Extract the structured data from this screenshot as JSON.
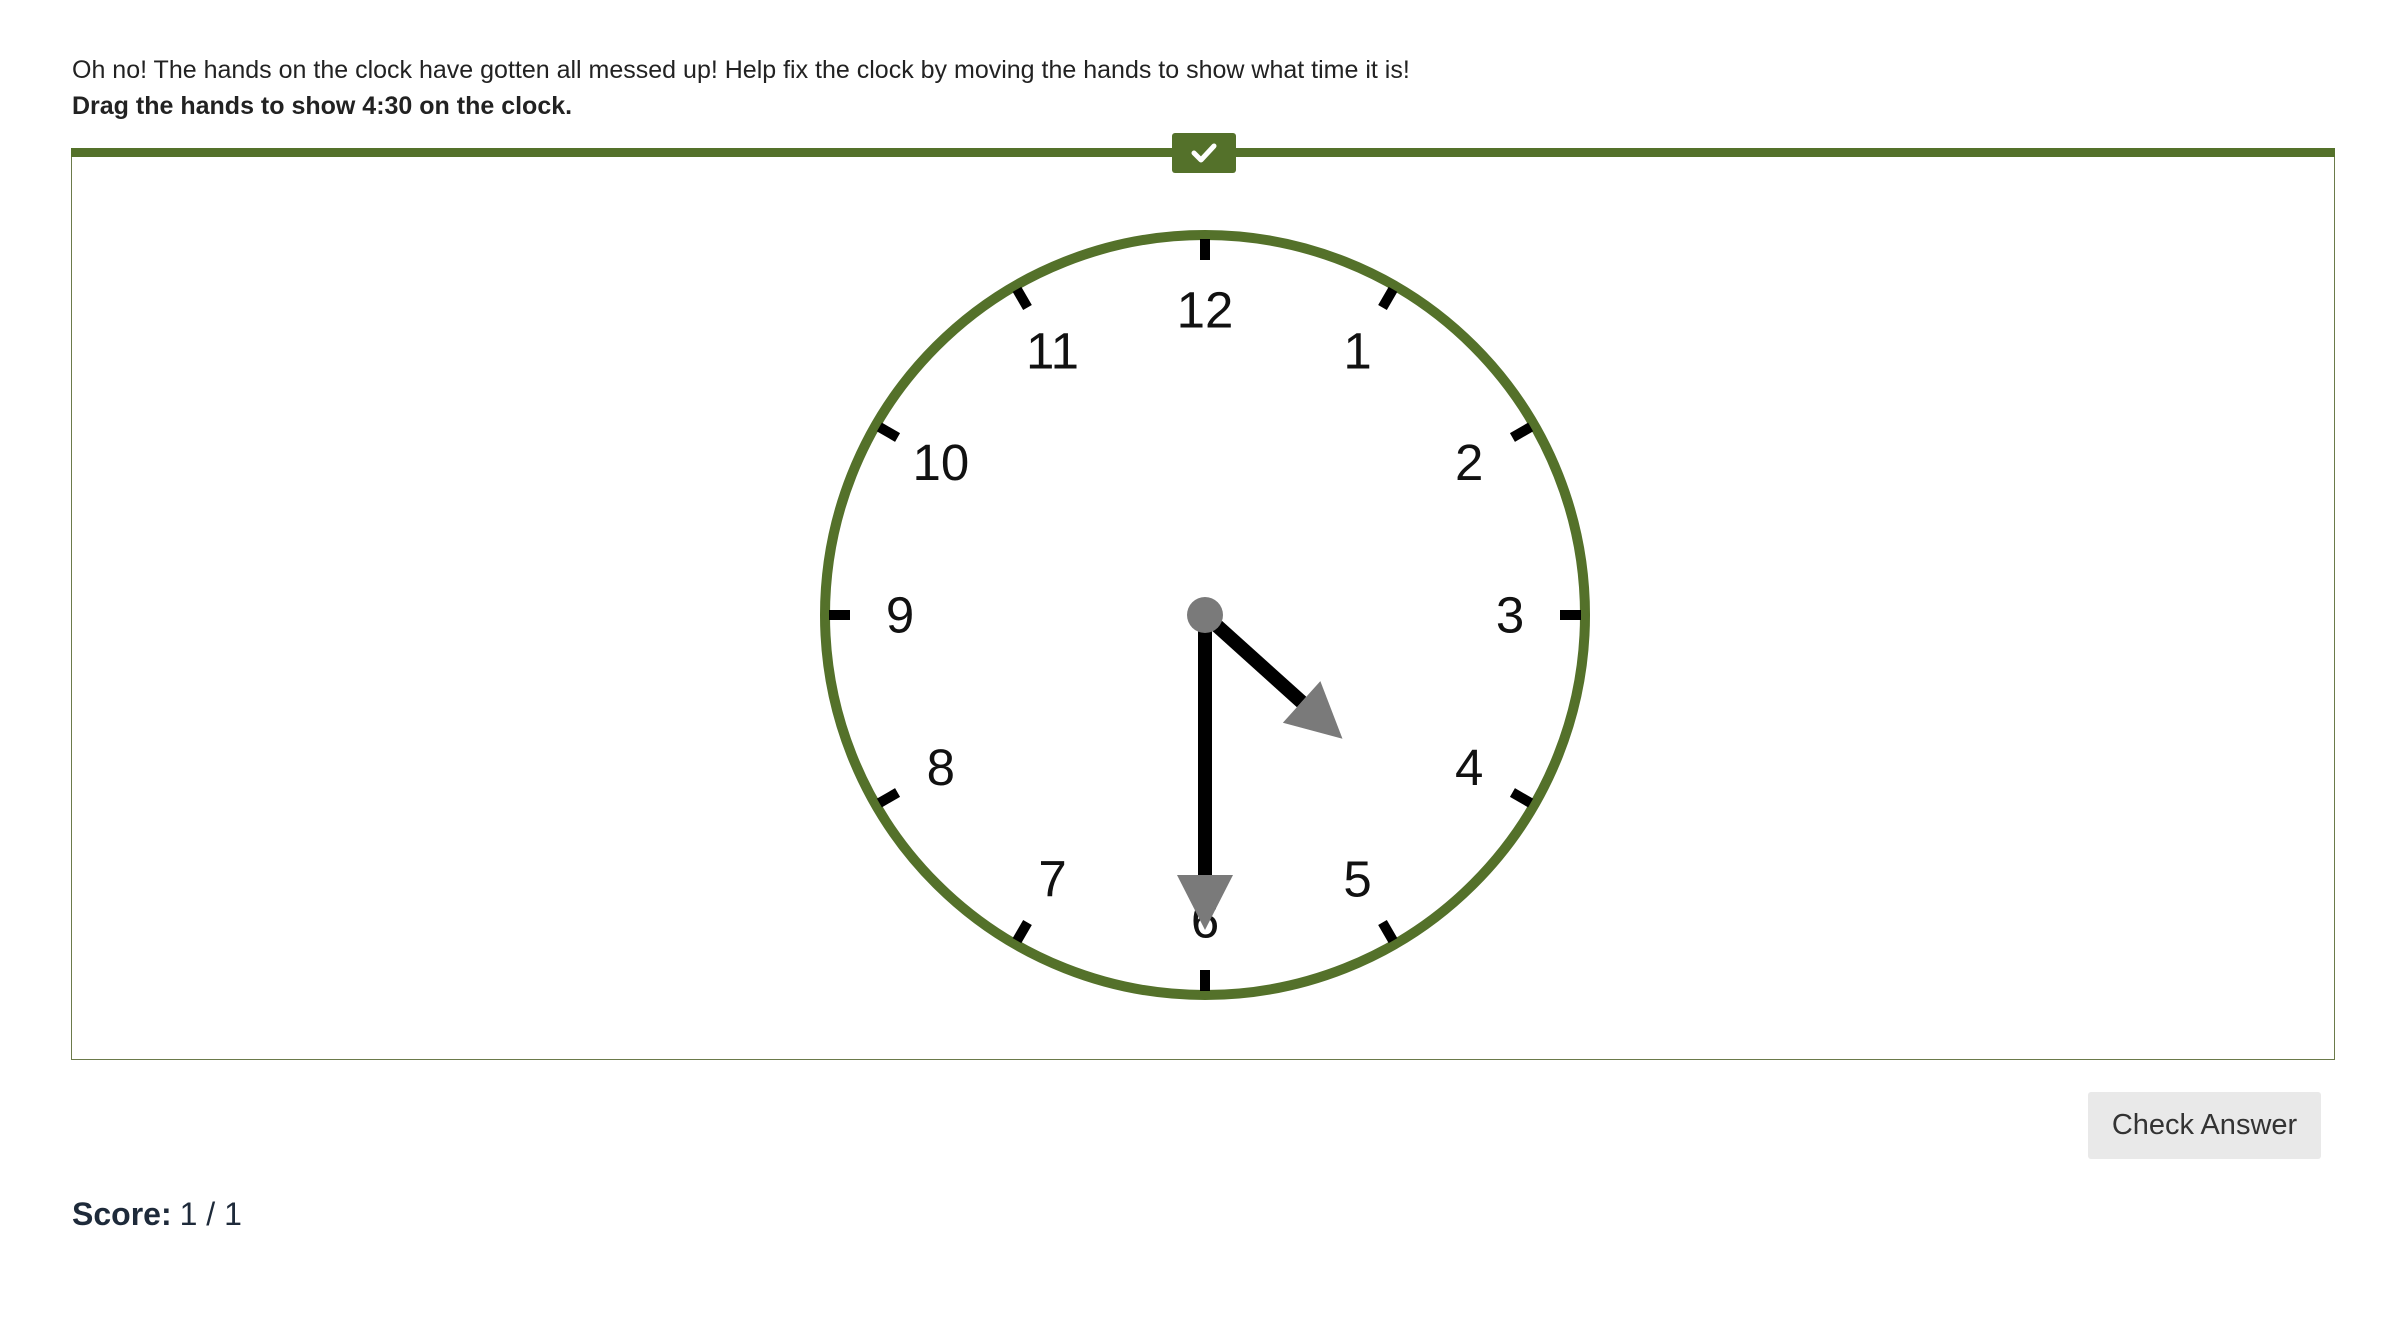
{
  "instructions": {
    "line1": "Oh no! The hands on the clock have gotten all messed up! Help fix the clock by moving the hands to show what time it is!",
    "line2": "Drag the hands to show 4:30 on the clock."
  },
  "status": {
    "icon": "checkmark-icon",
    "color": "#54712a"
  },
  "clock": {
    "numbers": [
      "12",
      "1",
      "2",
      "3",
      "4",
      "5",
      "6",
      "7",
      "8",
      "9",
      "10",
      "11"
    ],
    "time": {
      "hour": 4,
      "minute": 30
    },
    "rim_color": "#54712a",
    "hand_color": "#000000",
    "handle_color": "#7a7a7a"
  },
  "actions": {
    "check_answer_label": "Check Answer"
  },
  "score": {
    "label": "Score:",
    "value": "1 / 1"
  }
}
